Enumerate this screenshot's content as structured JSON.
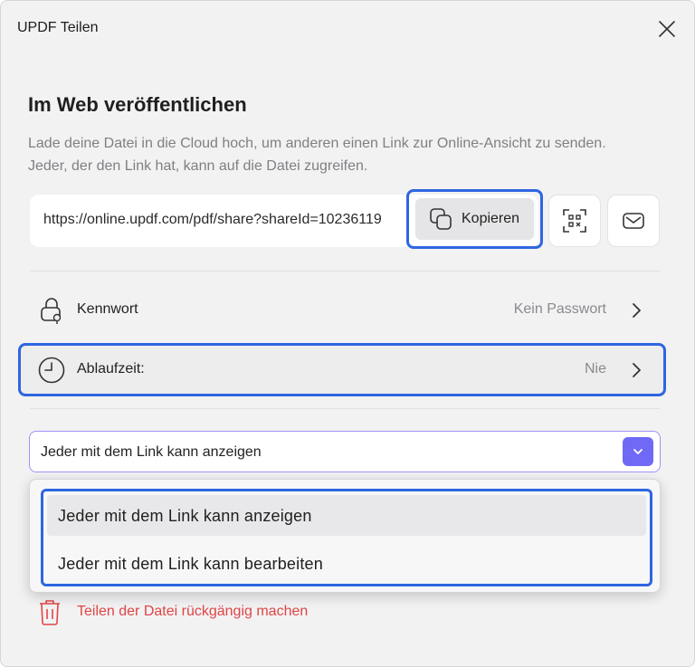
{
  "window": {
    "title": "UPDF Teilen"
  },
  "section": {
    "heading": "Im Web veröffentlichen",
    "description": "Lade deine Datei in die Cloud hoch, um anderen einen Link zur Online-Ansicht zu senden. Jeder, der den Link hat, kann auf die Datei zugreifen."
  },
  "share_link": {
    "url": "https://online.updf.com/pdf/share?shareId=10236119",
    "copy_label": "Kopieren"
  },
  "settings": {
    "password": {
      "label": "Kennwort",
      "value": "Kein Passwort"
    },
    "expiry": {
      "label": "Ablaufzeit:",
      "value": "Nie"
    }
  },
  "permission": {
    "selected": "Jeder mit dem Link kann anzeigen",
    "options": [
      "Jeder mit dem Link kann anzeigen",
      "Jeder mit dem Link kann bearbeiten"
    ]
  },
  "unshare": {
    "label": "Teilen der Datei rückgängig machen"
  },
  "colors": {
    "accent": "#6f69f6",
    "highlight": "#2f66e0",
    "danger": "#e04545"
  },
  "icons": [
    "close-icon",
    "copy-icon",
    "qr-code-icon",
    "mail-icon",
    "lock-icon",
    "clock-icon",
    "chevron-right-icon",
    "chevron-down-icon",
    "trash-icon"
  ]
}
